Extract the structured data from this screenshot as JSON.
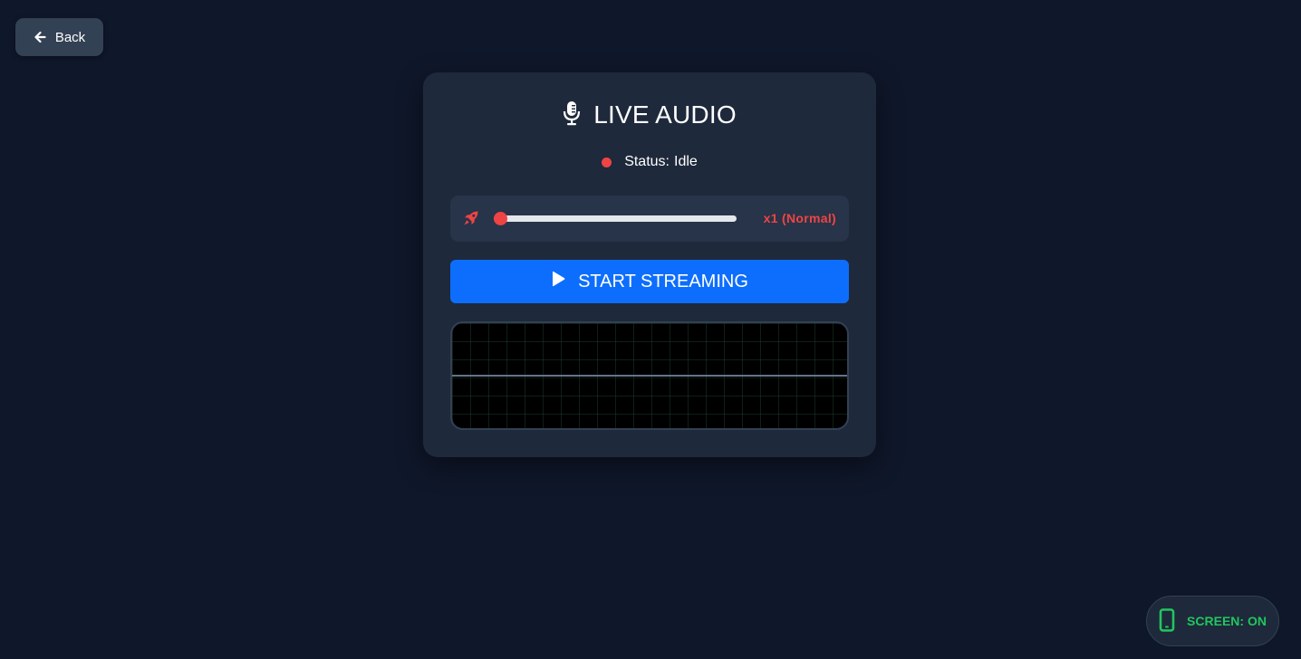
{
  "nav": {
    "back_label": "Back",
    "back_icon": "arrow-left-icon"
  },
  "card": {
    "title": "LIVE AUDIO",
    "title_icon": "microphone-icon",
    "status": {
      "label": "Status:",
      "value": "Idle",
      "dot_color": "#ef4444"
    },
    "speed": {
      "icon": "rocket-icon",
      "label": "x1 (Normal)",
      "slider_fraction": 0,
      "accent": "#ef4444"
    },
    "stream_button": {
      "label": "START STREAMING",
      "icon": "play-icon",
      "color": "#0d6efd"
    },
    "visualizer": {
      "line_color": "#64748b",
      "grid_color": "#224430"
    }
  },
  "screen_toggle": {
    "label": "SCREEN: ON",
    "icon": "mobile-phone-icon",
    "color": "#22c55e"
  },
  "colors": {
    "background": "#0f172a",
    "card": "#1e293b",
    "panel": "#273449"
  }
}
